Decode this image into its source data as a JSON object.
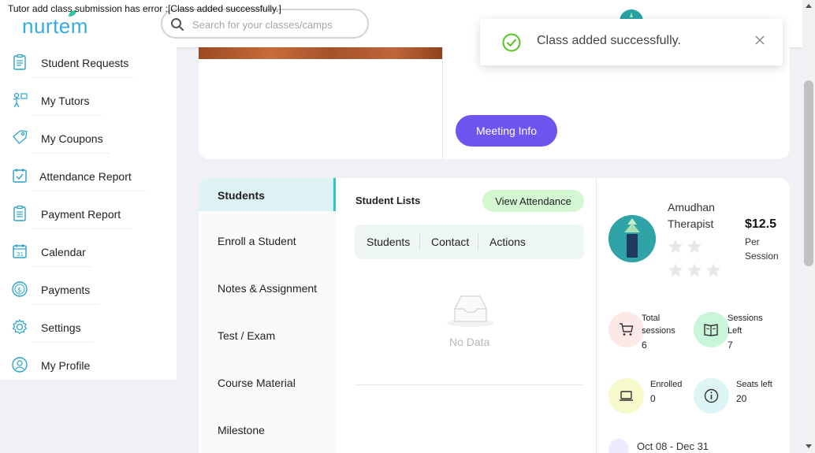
{
  "error_banner": "Tutor add class submission has error :[Class added successfully.]",
  "header": {
    "logo_text": "nurtem",
    "search_placeholder": "Search for your classes/camps"
  },
  "toast": {
    "message": "Class added successfully."
  },
  "sidebar": {
    "items": [
      {
        "label": "Student Requests",
        "icon": "clipboard-icon"
      },
      {
        "label": "My Tutors",
        "icon": "tutor-icon"
      },
      {
        "label": "My Coupons",
        "icon": "tag-icon"
      },
      {
        "label": "Attendance Report",
        "icon": "calendar-check-icon"
      },
      {
        "label": "Payment Report",
        "icon": "report-icon"
      },
      {
        "label": "Calendar",
        "icon": "calendar-icon"
      },
      {
        "label": "Payments",
        "icon": "dollar-icon"
      },
      {
        "label": "Settings",
        "icon": "gear-icon"
      },
      {
        "label": "My Profile",
        "icon": "profile-icon"
      }
    ]
  },
  "class_card": {
    "meeting_button": "Meeting Info"
  },
  "tabs": [
    {
      "label": "Students",
      "active": true
    },
    {
      "label": "Enroll a Student",
      "active": false
    },
    {
      "label": "Notes & Assignment",
      "active": false
    },
    {
      "label": "Test / Exam",
      "active": false
    },
    {
      "label": "Course Material",
      "active": false
    },
    {
      "label": "Milestone",
      "active": false
    }
  ],
  "student_list": {
    "title": "Student Lists",
    "view_attendance": "View Attendance",
    "columns": [
      "Students",
      "Contact",
      "Actions"
    ],
    "empty_text": "No Data"
  },
  "tutor": {
    "name_line1": "Amudhan",
    "name_line2": "Therapist",
    "price": "$12.5",
    "price_unit_line1": "Per",
    "price_unit_line2": "Session",
    "rating_out_of": 5,
    "rating": 0
  },
  "stats": {
    "total_sessions": {
      "label_line1": "Total",
      "label_line2": "sessions",
      "value": "6",
      "color": "#fde8e8"
    },
    "sessions_left": {
      "label_line1": "Sessions",
      "label_line2": "Left",
      "value": "7",
      "color": "#c9f5d9"
    },
    "enrolled": {
      "label_line1": "Enrolled",
      "value": "0",
      "color": "#f6f9c9"
    },
    "seats_left": {
      "label_line1": "Seats left",
      "value": "20",
      "color": "#def5f5"
    }
  },
  "date_range": "Oct 08 - Dec 31",
  "colors": {
    "accent": "#6f55f0",
    "brand": "#31aee0",
    "tab_active": "#ddf2f2",
    "view_attendance_bg": "#d3f7d0",
    "success": "#52c41a"
  }
}
